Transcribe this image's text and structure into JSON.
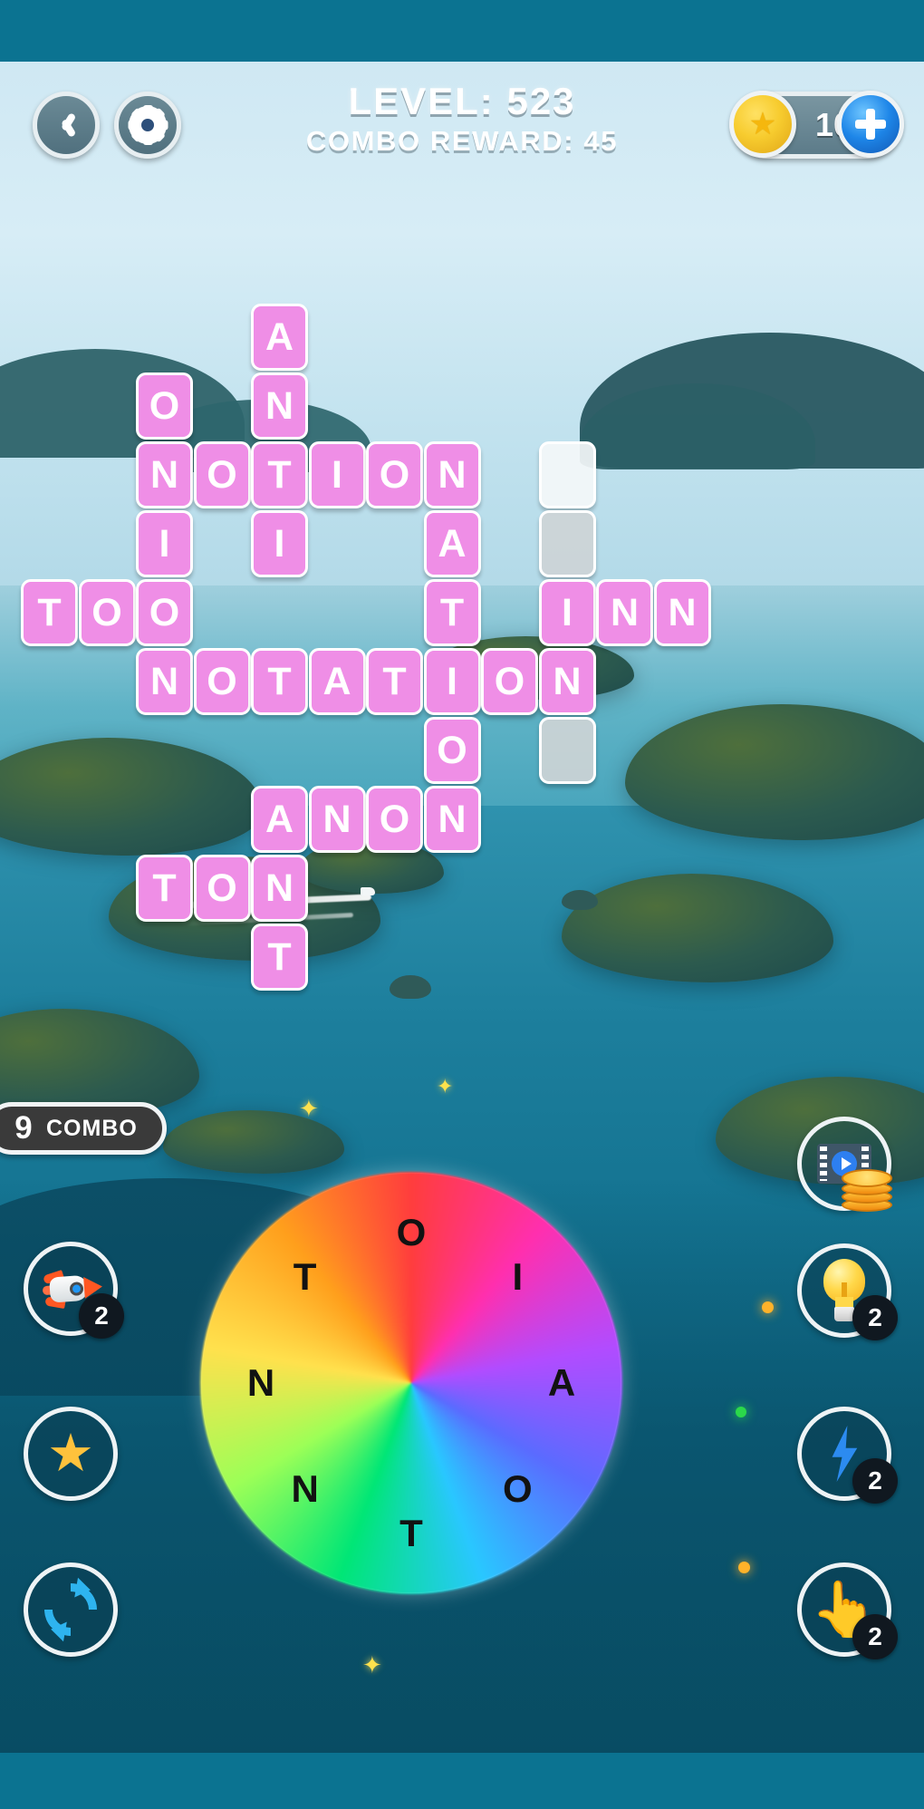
{
  "header": {
    "back_icon": "chevron-left-icon",
    "settings_icon": "gear-icon",
    "level_title": "LEVEL: 523",
    "combo_reward": "COMBO REWARD: 45",
    "coin_icon": "coin-star-icon",
    "coin_count": "10",
    "add_coins_icon": "plus-icon"
  },
  "grid": {
    "cols": 12,
    "rows": 9,
    "tiles": [
      {
        "letter": "A",
        "col": 4,
        "row": 0,
        "state": "filled"
      },
      {
        "letter": "O",
        "col": 2,
        "row": 1,
        "state": "filled"
      },
      {
        "letter": "N",
        "col": 4,
        "row": 1,
        "state": "filled"
      },
      {
        "letter": "N",
        "col": 2,
        "row": 2,
        "state": "filled"
      },
      {
        "letter": "O",
        "col": 3,
        "row": 2,
        "state": "filled"
      },
      {
        "letter": "T",
        "col": 4,
        "row": 2,
        "state": "filled"
      },
      {
        "letter": "I",
        "col": 5,
        "row": 2,
        "state": "filled"
      },
      {
        "letter": "O",
        "col": 6,
        "row": 2,
        "state": "filled"
      },
      {
        "letter": "N",
        "col": 7,
        "row": 2,
        "state": "filled"
      },
      {
        "letter": "",
        "col": 9,
        "row": 2,
        "state": "empty"
      },
      {
        "letter": "I",
        "col": 2,
        "row": 3,
        "state": "filled"
      },
      {
        "letter": "I",
        "col": 4,
        "row": 3,
        "state": "filled"
      },
      {
        "letter": "A",
        "col": 7,
        "row": 3,
        "state": "filled"
      },
      {
        "letter": "",
        "col": 9,
        "row": 3,
        "state": "empty-shaded"
      },
      {
        "letter": "T",
        "col": 0,
        "row": 4,
        "state": "filled"
      },
      {
        "letter": "O",
        "col": 1,
        "row": 4,
        "state": "filled"
      },
      {
        "letter": "O",
        "col": 2,
        "row": 4,
        "state": "filled"
      },
      {
        "letter": "T",
        "col": 7,
        "row": 4,
        "state": "filled"
      },
      {
        "letter": "I",
        "col": 9,
        "row": 4,
        "state": "filled"
      },
      {
        "letter": "N",
        "col": 10,
        "row": 4,
        "state": "filled"
      },
      {
        "letter": "N",
        "col": 11,
        "row": 4,
        "state": "filled"
      },
      {
        "letter": "N",
        "col": 2,
        "row": 5,
        "state": "filled"
      },
      {
        "letter": "O",
        "col": 3,
        "row": 5,
        "state": "filled"
      },
      {
        "letter": "T",
        "col": 4,
        "row": 5,
        "state": "filled"
      },
      {
        "letter": "A",
        "col": 5,
        "row": 5,
        "state": "filled"
      },
      {
        "letter": "T",
        "col": 6,
        "row": 5,
        "state": "filled"
      },
      {
        "letter": "I",
        "col": 7,
        "row": 5,
        "state": "filled"
      },
      {
        "letter": "O",
        "col": 8,
        "row": 5,
        "state": "filled"
      },
      {
        "letter": "N",
        "col": 9,
        "row": 5,
        "state": "filled"
      },
      {
        "letter": "O",
        "col": 7,
        "row": 6,
        "state": "filled"
      },
      {
        "letter": "",
        "col": 9,
        "row": 6,
        "state": "empty-shaded"
      },
      {
        "letter": "A",
        "col": 4,
        "row": 7,
        "state": "filled"
      },
      {
        "letter": "N",
        "col": 5,
        "row": 7,
        "state": "filled"
      },
      {
        "letter": "O",
        "col": 6,
        "row": 7,
        "state": "filled"
      },
      {
        "letter": "N",
        "col": 7,
        "row": 7,
        "state": "filled"
      },
      {
        "letter": "T",
        "col": 2,
        "row": 8,
        "state": "filled"
      },
      {
        "letter": "O",
        "col": 3,
        "row": 8,
        "state": "filled"
      },
      {
        "letter": "N",
        "col": 4,
        "row": 8,
        "state": "filled"
      },
      {
        "letter": "T",
        "col": 4,
        "row": 9,
        "state": "filled"
      }
    ]
  },
  "combo_badge": {
    "count": "9",
    "label": "COMBO"
  },
  "wheel": {
    "letters": [
      {
        "letter": "O",
        "angle": -90
      },
      {
        "letter": "I",
        "angle": -45
      },
      {
        "letter": "A",
        "angle": 0
      },
      {
        "letter": "O",
        "angle": 45
      },
      {
        "letter": "T",
        "angle": 90
      },
      {
        "letter": "N",
        "angle": 135
      },
      {
        "letter": "N",
        "angle": 180
      },
      {
        "letter": "T",
        "angle": -135
      }
    ]
  },
  "left_buttons": [
    {
      "name": "rocket-booster-button",
      "icon": "rocket-icon",
      "badge": "2"
    },
    {
      "name": "star-button",
      "icon": "star-icon",
      "badge": ""
    },
    {
      "name": "shuffle-button",
      "icon": "shuffle-icon",
      "badge": ""
    }
  ],
  "right_buttons": [
    {
      "name": "watch-video-coins-button",
      "icon": "video-coins-icon",
      "badge": ""
    },
    {
      "name": "hint-button",
      "icon": "lightbulb-icon",
      "badge": "2"
    },
    {
      "name": "boost-button",
      "icon": "lightning-bolt-icon",
      "badge": "2"
    },
    {
      "name": "reveal-letter-button",
      "icon": "pointing-hand-icon",
      "badge": "2"
    }
  ],
  "colors": {
    "tile_fill": "#ef8ee6",
    "tile_text": "#ffffff",
    "bezel": "#0b7391",
    "badge_dark": "#101820",
    "coin_yellow": "#f7cc2f"
  }
}
